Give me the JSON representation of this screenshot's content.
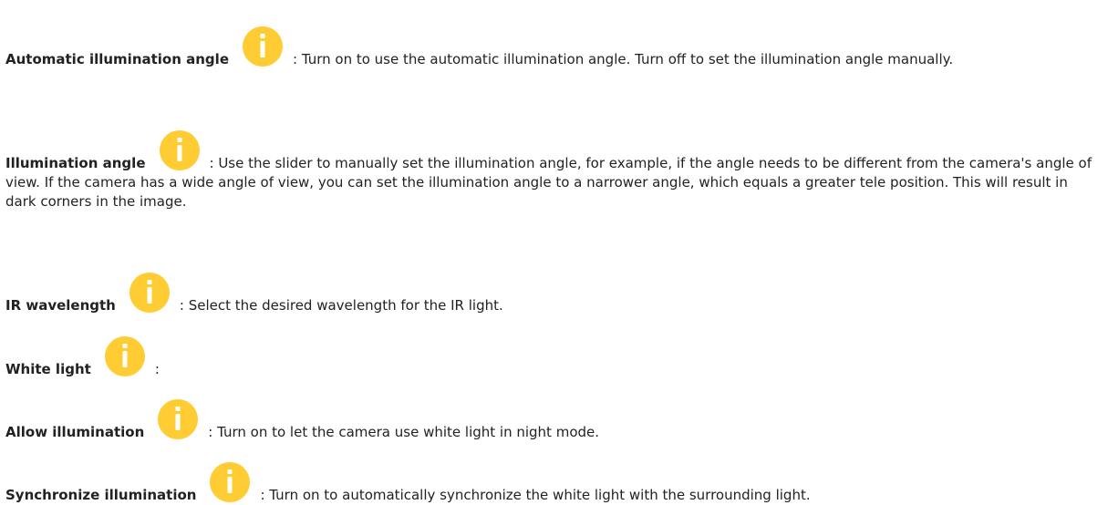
{
  "icon": {
    "name": "info-icon",
    "color": "#FFCC33",
    "glyph_color": "#FFFFFF"
  },
  "entries": [
    {
      "term": "Automatic illumination angle",
      "description": ": Turn on to use the automatic illumination angle. Turn off to set the illumination angle manually."
    },
    {
      "term": "Illumination angle",
      "description": ": Use the slider to manually set the illumination angle, for example, if the angle needs to be different from the camera's angle of view. If the camera has a wide angle of view, you can set the illumination angle to a narrower angle, which equals a greater tele position. This will result in dark corners in the image."
    },
    {
      "term": "IR wavelength",
      "description": ": Select the desired wavelength for the IR light."
    },
    {
      "term": "White light",
      "description": ":"
    },
    {
      "term": "Allow illumination",
      "description": ": Turn on to let the camera use white light in night mode."
    },
    {
      "term": "Synchronize illumination",
      "description": ": Turn on to automatically synchronize the white light with the surrounding light."
    }
  ]
}
